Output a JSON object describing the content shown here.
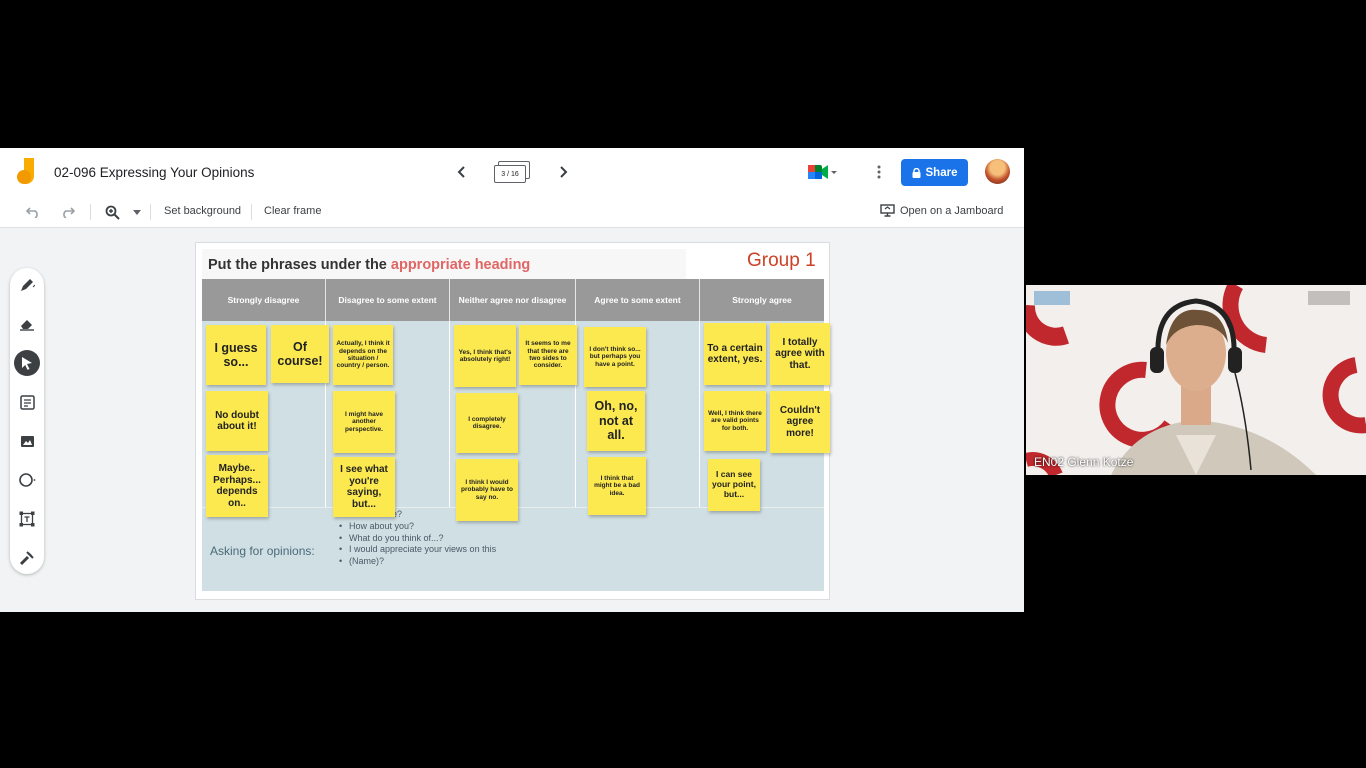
{
  "app": {
    "doc_title": "02-096 Expressing Your Opinions",
    "frame_indicator": "3 / 16",
    "share_label": "Share"
  },
  "toolbar": {
    "set_background": "Set background",
    "clear_frame": "Clear frame",
    "open_on_jamboard": "Open on a Jamboard"
  },
  "frame": {
    "title_plain": "Put the phrases under the ",
    "title_highlight": "appropriate heading",
    "group_label": "Group 1",
    "columns": [
      "Strongly disagree",
      "Disagree to some extent",
      "Neither agree nor disagree",
      "Agree to some extent",
      "Strongly agree"
    ],
    "ask_label": "Asking for opinions:",
    "ask_items": [
      "How about you?",
      "What do you think of...?",
      "I would appreciate your views on this",
      "(Name)?"
    ],
    "ask_partial_text": "e?",
    "notes": {
      "n1": "I guess so...",
      "n2": "Of course!",
      "n3": "No doubt about it!",
      "n4": "Maybe.. Perhaps... depends on..",
      "n5": "Actually, I think it depends on the situation / country / person.",
      "n6": "I might have another perspective.",
      "n7": "I see what you're saying, but...",
      "n8": "Yes, I think that's absolutely right!",
      "n9": "It seems to me that there are two sides to consider.",
      "n10": "I completely disagree.",
      "n11": "I think I would probably have to say no.",
      "n12": "I don't think so... but perhaps you have a point.",
      "n13": "Oh, no, not at all.",
      "n14": "I think that might be a bad idea.",
      "n15": "To a certain extent, yes.",
      "n16": "I totally agree with that.",
      "n17": "Well, I think there are valid points for both.",
      "n18": "Couldn't agree more!",
      "n19": "I can see your point, but..."
    }
  },
  "video": {
    "participant_name": "EN02 Glenn Kotze"
  },
  "colors": {
    "share_blue": "#1a73e8",
    "sticky_yellow": "#fce94f",
    "heading_gray": "#999999",
    "table_blue": "#d0dfe3",
    "highlight_red": "#e06666"
  }
}
